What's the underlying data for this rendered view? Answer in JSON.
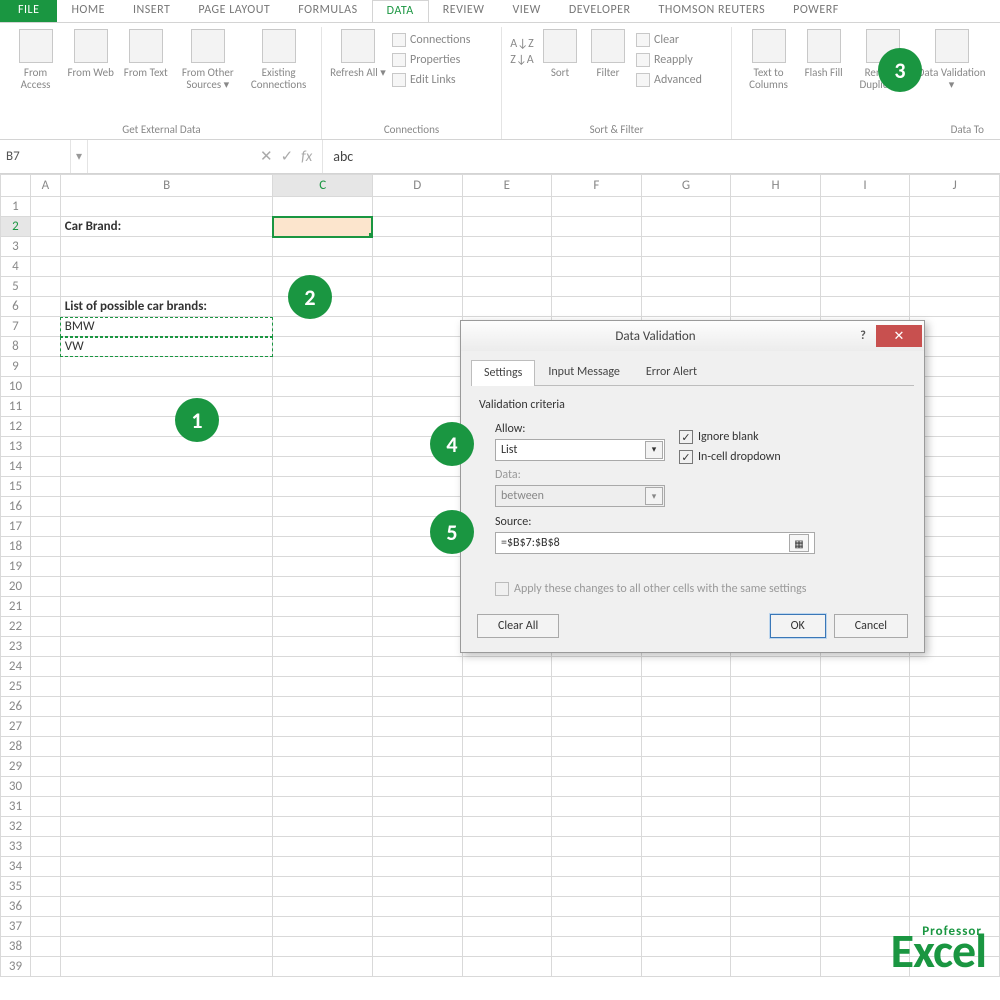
{
  "tabs": {
    "file": "FILE",
    "items": [
      "HOME",
      "INSERT",
      "PAGE LAYOUT",
      "FORMULAS",
      "DATA",
      "REVIEW",
      "VIEW",
      "DEVELOPER",
      "THOMSON REUTERS",
      "POWERF"
    ],
    "active": "DATA"
  },
  "ribbon": {
    "ext": {
      "label": "Get External Data",
      "access": "From Access",
      "web": "From Web",
      "text": "From Text",
      "other": "From Other Sources ▾",
      "existing": "Existing Connections"
    },
    "conn": {
      "label": "Connections",
      "refresh": "Refresh All ▾",
      "c1": "Connections",
      "c2": "Properties",
      "c3": "Edit Links"
    },
    "sort": {
      "label": "Sort & Filter",
      "sort": "Sort",
      "filter": "Filter",
      "clear": "Clear",
      "reapply": "Reapply",
      "advanced": "Advanced"
    },
    "tools": {
      "label": "Data To",
      "ttc": "Text to Columns",
      "flash": "Flash Fill",
      "dup": "Remove Duplicates",
      "val": "Data Validation ▾"
    }
  },
  "formula_bar": {
    "name_box": "B7",
    "formula": "abc",
    "fx": "fx"
  },
  "columns": [
    "A",
    "B",
    "C",
    "D",
    "E",
    "F",
    "G",
    "H",
    "I",
    "J"
  ],
  "rows_count": 39,
  "cells": {
    "B2": "Car Brand:",
    "B6": "List of possible car brands:",
    "B7": "BMW",
    "B8": "VW"
  },
  "badges": {
    "b1": "1",
    "b2": "2",
    "b3": "3",
    "b4": "4",
    "b5": "5"
  },
  "dialog": {
    "title": "Data Validation",
    "tabs": [
      "Settings",
      "Input Message",
      "Error Alert"
    ],
    "section": "Validation criteria",
    "allow_label": "Allow:",
    "allow_value": "List",
    "data_label": "Data:",
    "data_value": "between",
    "source_label": "Source:",
    "source_value": "=$B$7:$B$8",
    "ignore": "Ignore blank",
    "incell": "In-cell dropdown",
    "apply": "Apply these changes to all other cells with the same settings",
    "clear": "Clear All",
    "ok": "OK",
    "cancel": "Cancel"
  },
  "watermark": {
    "small": "Professor",
    "big": "Excel"
  }
}
